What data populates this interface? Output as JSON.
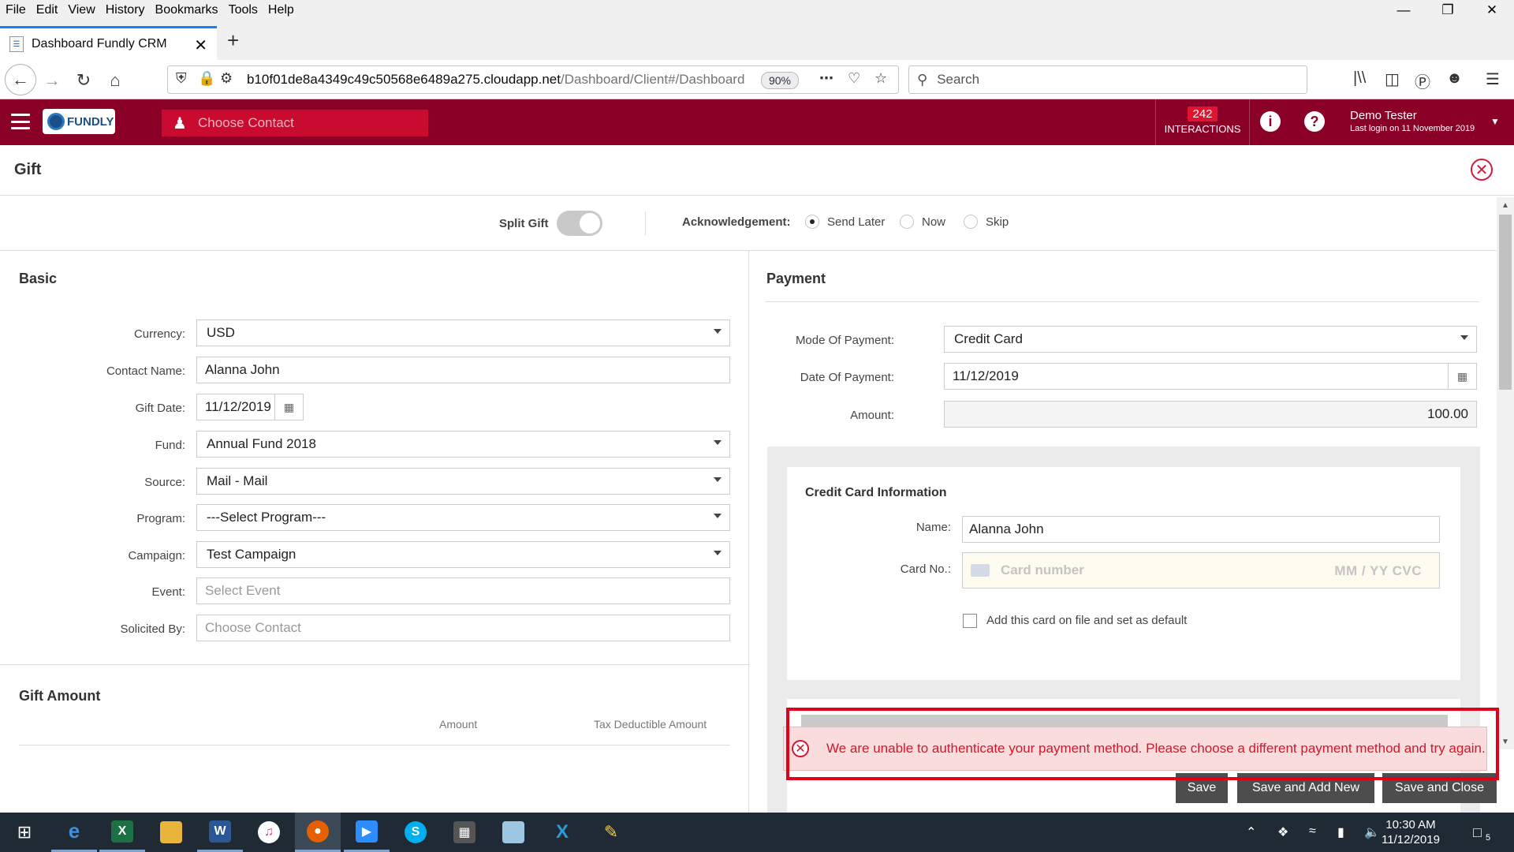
{
  "browser": {
    "menu": [
      "File",
      "Edit",
      "View",
      "History",
      "Bookmarks",
      "Tools",
      "Help"
    ],
    "tab_title": "Dashboard Fundly CRM",
    "url_host": "b10f01de8a4349c49c50568e6489a275.cloudapp.net",
    "url_path": "/Dashboard/Client#/Dashboard",
    "zoom": "90%",
    "search_placeholder": "Search"
  },
  "app_header": {
    "logo_text": "FUNDLY",
    "choose_contact_placeholder": "Choose Contact",
    "interactions_count": "242",
    "interactions_label": "INTERACTIONS",
    "user_name": "Demo Tester",
    "last_login": "Last login on 11 November 2019"
  },
  "gift": {
    "title": "Gift",
    "split_gift_label": "Split Gift",
    "split_gift_on": false,
    "ack_label": "Acknowledgement:",
    "ack_options": [
      "Send Later",
      "Now",
      "Skip"
    ],
    "ack_selected": "Send Later"
  },
  "basic": {
    "title": "Basic",
    "fields": {
      "currency": {
        "label": "Currency:",
        "value": "USD"
      },
      "contact_name": {
        "label": "Contact Name:",
        "value": "Alanna John"
      },
      "gift_date": {
        "label": "Gift Date:",
        "value": "11/12/2019"
      },
      "fund": {
        "label": "Fund:",
        "value": "Annual Fund 2018"
      },
      "source": {
        "label": "Source:",
        "value": "Mail - Mail"
      },
      "program": {
        "label": "Program:",
        "value": "---Select Program---"
      },
      "campaign": {
        "label": "Campaign:",
        "value": "Test Campaign"
      },
      "event": {
        "label": "Event:",
        "placeholder": "Select Event"
      },
      "solicited_by": {
        "label": "Solicited By:",
        "placeholder": "Choose Contact"
      }
    }
  },
  "gift_amount": {
    "title": "Gift Amount",
    "col_amount": "Amount",
    "col_tax": "Tax Deductible Amount"
  },
  "payment": {
    "title": "Payment",
    "mode": {
      "label": "Mode Of Payment:",
      "value": "Credit Card"
    },
    "date": {
      "label": "Date Of Payment:",
      "value": "11/12/2019"
    },
    "amount": {
      "label": "Amount:",
      "value": "100.00"
    },
    "cc": {
      "title": "Credit Card Information",
      "name_label": "Name:",
      "name_value": "Alanna John",
      "card_label": "Card No.:",
      "card_placeholder": "Card number",
      "card_exp_cvc": "MM / YY  CVC",
      "save_card_label": "Add this card on file and set as default"
    }
  },
  "footer": {
    "save": "Save",
    "save_add_new": "Save and Add New",
    "save_close": "Save and Close"
  },
  "error": {
    "message": "We are unable to authenticate your payment method. Please choose a different payment method and try again.",
    "color": "#d4152b"
  },
  "taskbar": {
    "time": "10:30 AM",
    "date": "11/12/2019",
    "notifications": "5"
  },
  "colors": {
    "header": "#8b0027",
    "choose_contact": "#c80b2e",
    "badge": "#e0142e"
  }
}
